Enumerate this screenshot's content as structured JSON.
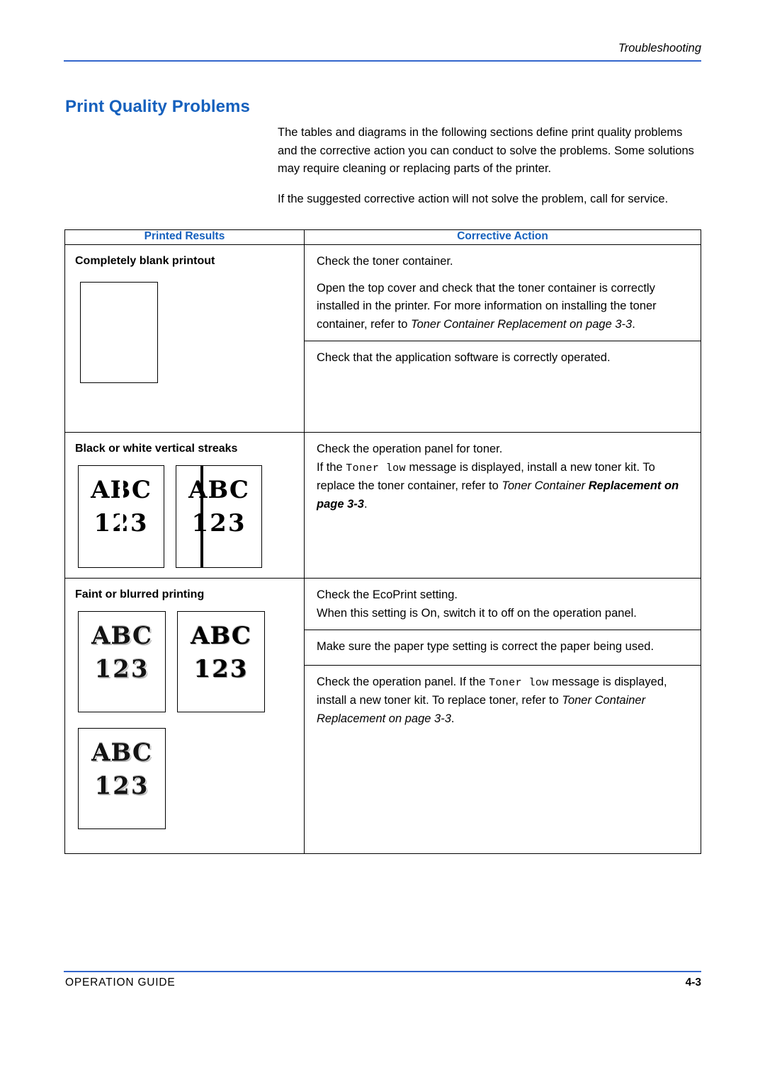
{
  "header": {
    "running_head": "Troubleshooting"
  },
  "title": "Print Quality Problems",
  "intro": {
    "para1": "The tables and diagrams in the following sections define print quality problems and the corrective action you can conduct to solve the problems. Some solutions may require cleaning or replacing parts of the printer.",
    "para2": "If the suggested corrective action will not solve the problem, call for service."
  },
  "table": {
    "headers": {
      "left": "Printed Results",
      "right": "Corrective Action"
    },
    "rows": [
      {
        "label": "Completely blank printout",
        "actions": [
          {
            "segments": [
              {
                "text": "Check the toner container.",
                "style": "normal"
              }
            ]
          },
          {
            "segments": [
              {
                "text": "Open the top cover and check that the toner container is correctly installed in the printer. For more information on installing the toner container, refer to ",
                "style": "normal"
              },
              {
                "text": "Toner Container Replacement on page 3-3",
                "style": "italic"
              },
              {
                "text": ".",
                "style": "normal"
              }
            ]
          },
          {
            "segments": [
              {
                "text": "Check that the application software is correctly operated.",
                "style": "normal"
              }
            ]
          }
        ]
      },
      {
        "label": "Black or white vertical streaks",
        "actions": [
          {
            "segments": [
              {
                "text": "Check the operation panel for toner.",
                "style": "normal"
              }
            ]
          },
          {
            "segments": [
              {
                "text": "If the ",
                "style": "normal"
              },
              {
                "text": "Toner low",
                "style": "mono"
              },
              {
                "text": " message is displayed, install a new toner kit. To replace the toner container, refer to ",
                "style": "normal"
              },
              {
                "text": "Toner Container ",
                "style": "italic"
              },
              {
                "text": "Replacement on page 3-3",
                "style": "bolditalic"
              },
              {
                "text": ".",
                "style": "normal"
              }
            ]
          }
        ]
      },
      {
        "label": "Faint or blurred printing",
        "actions": [
          {
            "segments": [
              {
                "text": "Check the EcoPrint setting.",
                "style": "normal"
              }
            ]
          },
          {
            "segments": [
              {
                "text": "When this setting is On, switch it to off on  the operation panel.",
                "style": "normal"
              }
            ]
          },
          {
            "segments": [
              {
                "text": "Make sure the paper type setting is correct the paper being used.",
                "style": "normal"
              }
            ]
          },
          {
            "segments": [
              {
                "text": "Check the operation panel. If the ",
                "style": "normal"
              },
              {
                "text": "Toner low",
                "style": "mono"
              },
              {
                "text": " message is displayed, install a new toner kit. To replace toner, refer to ",
                "style": "normal"
              },
              {
                "text": "Toner Container Replacement on page 3-3",
                "style": "italic"
              },
              {
                "text": ".",
                "style": "normal"
              }
            ]
          }
        ]
      }
    ]
  },
  "samples": {
    "abc": "ABC",
    "num": "123"
  },
  "footer": {
    "left": "OPERATION GUIDE",
    "right": "4-3"
  },
  "colors": {
    "accent": "#1560bd",
    "rule": "#3366cc",
    "text": "#000000"
  }
}
